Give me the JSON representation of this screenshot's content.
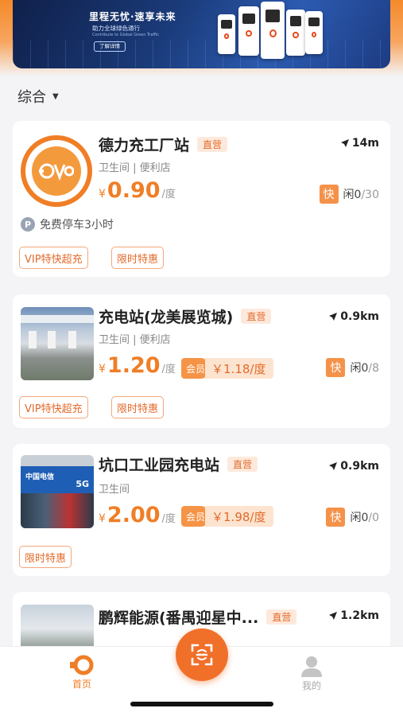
{
  "banner": {
    "title": "里程无忧·速享未来",
    "subtitle": "助力全球绿色通行",
    "subtitle_en": "Contribute to Global Green Traffic",
    "button": "了解详情"
  },
  "filter": {
    "label": "综合"
  },
  "stations": [
    {
      "name": "德力充工厂站",
      "tag": "直营",
      "distance": "14m",
      "amenities": "卫生间 | 便利店",
      "price_currency": "¥",
      "price": "0.90",
      "price_unit": "/度",
      "fast_label": "快",
      "idle_label": "闲",
      "idle": "0",
      "total": "/30",
      "parking_icon": "P",
      "parking": "免费停车3小时",
      "promos": [
        "VIP特快超充",
        "限时特惠"
      ]
    },
    {
      "name": "充电站(龙美展览城)",
      "tag": "直营",
      "distance": "0.9km",
      "amenities": "卫生间 | 便利店",
      "price_currency": "¥",
      "price": "1.20",
      "price_unit": "/度",
      "member_label": "会员",
      "member_price": "￥1.18/度",
      "fast_label": "快",
      "idle_label": "闲",
      "idle": "0",
      "total": "/8",
      "promos": [
        "VIP特快超充",
        "限时特惠"
      ]
    },
    {
      "name": "坑口工业园充电站",
      "tag": "直营",
      "distance": "0.9km",
      "amenities": "卫生间",
      "price_currency": "¥",
      "price": "2.00",
      "price_unit": "/度",
      "member_label": "会员",
      "member_price": "￥1.98/度",
      "fast_label": "快",
      "idle_label": "闲",
      "idle": "0",
      "total": "/0",
      "promos": [
        "限时特惠"
      ]
    },
    {
      "name": "鹏辉能源(番禺迎星中...",
      "tag": "直营",
      "distance": "1.2km"
    }
  ],
  "thumb_text": {
    "telecom": "中国电信",
    "fiveg": "5G"
  },
  "tabbar": {
    "home": "首页",
    "me": "我的"
  },
  "colors": {
    "accent": "#f07e26",
    "tag_bg": "#fde9dc",
    "banner_bg": "#1a3a78"
  },
  "icons": [
    "location-arrow-icon",
    "parking-icon",
    "scan-icon",
    "home-logo-icon",
    "user-icon",
    "caret-down-icon"
  ]
}
